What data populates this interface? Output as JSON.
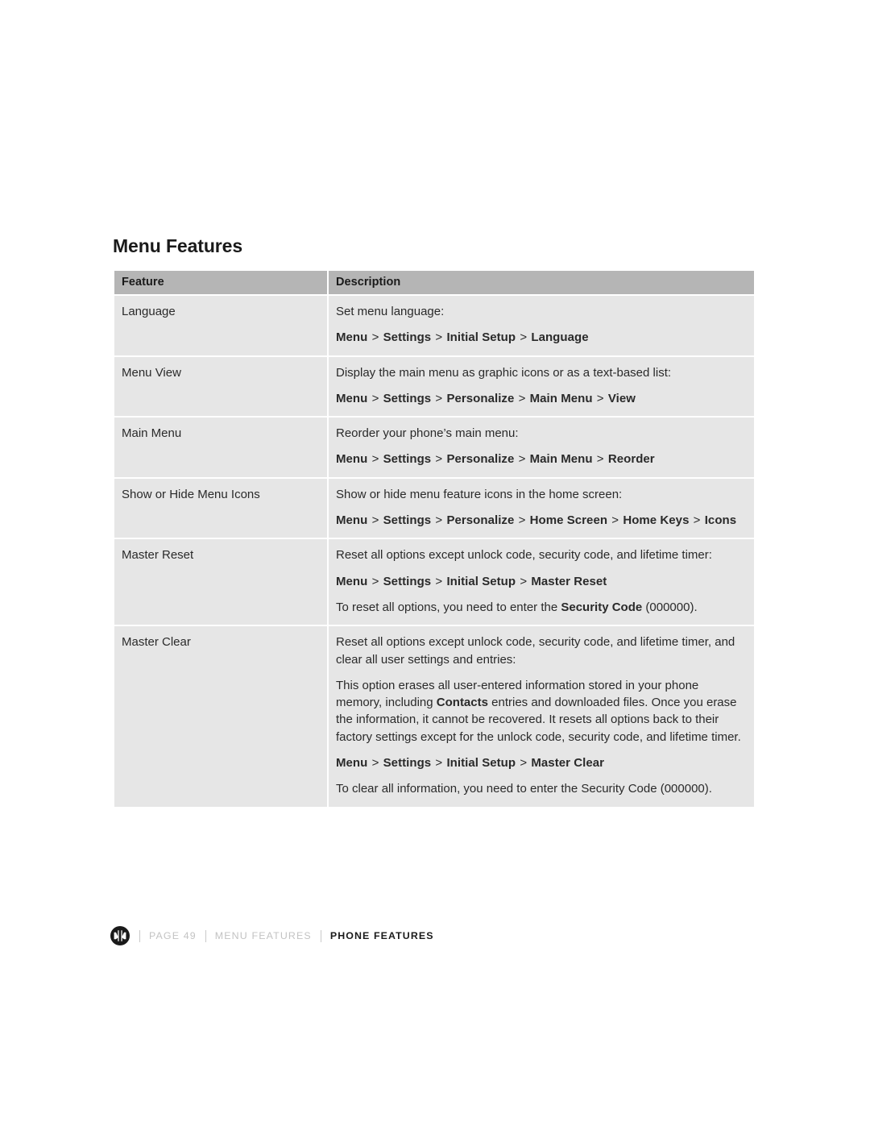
{
  "document": {
    "section_title": "Menu Features"
  },
  "table": {
    "headers": {
      "feature": "Feature",
      "description": "Description"
    },
    "rows": [
      {
        "feature": "Language",
        "lines": [
          {
            "text": "Set menu language:"
          },
          {
            "path": [
              "Menu",
              "Settings",
              "Initial Setup",
              "Language"
            ]
          }
        ]
      },
      {
        "feature": "Menu View",
        "lines": [
          {
            "text": "Display the main menu as graphic icons or as a text-based list:"
          },
          {
            "path": [
              "Menu",
              "Settings",
              "Personalize",
              "Main Menu",
              "View"
            ]
          }
        ]
      },
      {
        "feature": "Main Menu",
        "lines": [
          {
            "text": "Reorder your phone’s main menu:"
          },
          {
            "path": [
              "Menu",
              "Settings",
              "Personalize",
              "Main Menu",
              "Reorder"
            ]
          }
        ]
      },
      {
        "feature": "Show or Hide Menu Icons",
        "lines": [
          {
            "text": "Show or hide menu feature icons in the home screen:"
          },
          {
            "path": [
              "Menu",
              "Settings",
              "Personalize",
              "Home Screen",
              "Home Keys",
              "Icons"
            ]
          }
        ]
      },
      {
        "feature": "Master Reset",
        "lines": [
          {
            "text": "Reset all options except unlock code, security code, and lifetime timer:"
          },
          {
            "path": [
              "Menu",
              "Settings",
              "Initial Setup",
              "Master Reset"
            ]
          },
          {
            "rich": [
              {
                "t": "To reset all options, you need to enter the ",
                "bold": false
              },
              {
                "t": "Security Code",
                "bold": true
              },
              {
                "t": " (000000).",
                "bold": false
              }
            ]
          }
        ]
      },
      {
        "feature": "Master Clear",
        "lines": [
          {
            "text": "Reset all options except unlock code, security code, and lifetime timer, and clear all user settings and entries:"
          },
          {
            "rich": [
              {
                "t": "This option erases all user-entered information stored in your phone memory, including ",
                "bold": false
              },
              {
                "t": "Contacts",
                "bold": true
              },
              {
                "t": " entries and downloaded files. Once you erase the information, it cannot be recovered. It resets all options back to their factory settings except for the unlock code, security code, and lifetime timer.",
                "bold": false
              }
            ]
          },
          {
            "path": [
              "Menu",
              "Settings",
              "Initial Setup",
              "Master Clear"
            ]
          },
          {
            "text": "To clear all information, you need to enter the Security Code (000000)."
          }
        ]
      }
    ],
    "path_separator": ">"
  },
  "footer": {
    "logo": "motorola-logo-icon",
    "page_label": "PAGE 49",
    "section_label": "MENU FEATURES",
    "chapter_label": "PHONE FEATURES"
  },
  "colors": {
    "table_header_bg": "#b5b5b5",
    "table_cell_bg": "#e6e6e6",
    "page_bg": "#ffffff",
    "text": "#231f20",
    "footer_muted": "#c3c3c3"
  }
}
